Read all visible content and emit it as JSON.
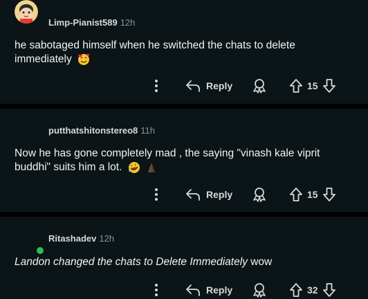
{
  "comments": [
    {
      "username": "Limp-Pianist589",
      "time": "12h",
      "text": "he sabotaged himself when he switched the chats to delete immediately",
      "reply_label": "Reply",
      "score": "15"
    },
    {
      "username": "putthatshitonstereo8",
      "time": "11h",
      "text": "Now he has gone completely mad , the saying \"vinash kale viprit buddhi\" suits him a lot.",
      "reply_label": "Reply",
      "score": "15"
    },
    {
      "username": "Ritashadev",
      "time": "12h",
      "text": "Landon changed the chats to Delete Immediately",
      "text_suffix": " wow",
      "reply_label": "Reply",
      "score": "32"
    }
  ],
  "icons": {
    "more": "more-vertical-icon",
    "reply": "reply-arrow-icon",
    "award": "award-icon",
    "upvote": "upvote-icon",
    "downvote": "downvote-icon"
  },
  "colors": {
    "background": "#0b1416",
    "separator": "#000000",
    "online": "#2ebd59"
  }
}
